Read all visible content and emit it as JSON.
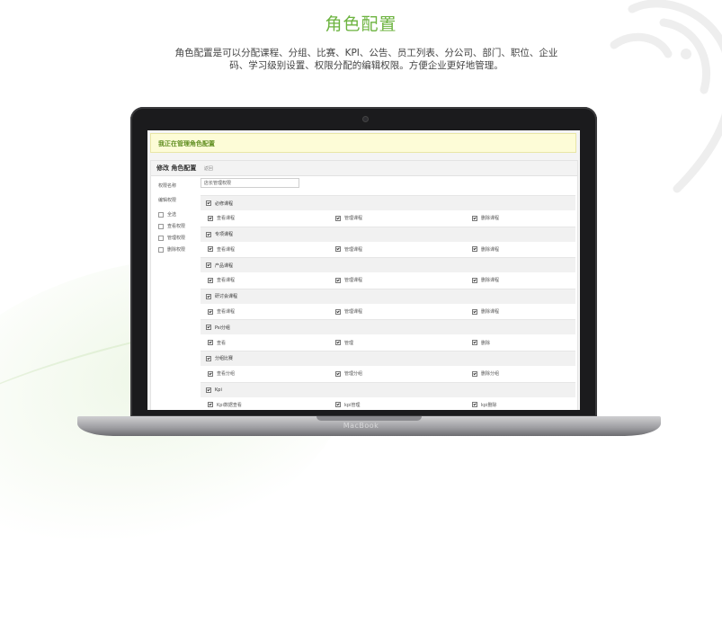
{
  "page": {
    "title": "角色配置",
    "description": "角色配置是可以分配课程、分组、比赛、KPI、公告、员工列表、分公司、部门、职位、企业码、学习级别设置、权限分配的编辑权限。方便企业更好地管理。"
  },
  "laptop": {
    "brand": "MacBook"
  },
  "app": {
    "notice": "我正在管理角色配置",
    "panel_title": "修改 角色配置",
    "panel_sub": "返回",
    "name_label": "权限名称",
    "name_value": "店长管理权限",
    "permissions_label": "编辑权限",
    "quick_options": [
      "全选",
      "查看权限",
      "管理权限",
      "删除权限"
    ],
    "groups": [
      {
        "name": "必修课程",
        "items": [
          "查看课程",
          "管理课程",
          "删除课程"
        ]
      },
      {
        "name": "专项课程",
        "items": [
          "查看课程",
          "管理课程",
          "删除课程"
        ]
      },
      {
        "name": "产品课程",
        "items": [
          "查看课程",
          "管理课程",
          "删除课程"
        ]
      },
      {
        "name": "研讨会课程",
        "items": [
          "查看课程",
          "管理课程",
          "删除课程"
        ]
      },
      {
        "name": "Psi分组",
        "items": [
          "查看",
          "管理",
          "删除"
        ]
      },
      {
        "name": "分组比赛",
        "items": [
          "查看分组",
          "管理分组",
          "删除分组"
        ]
      },
      {
        "name": "Kpi",
        "items": [
          "Kpi数据查看",
          "kpi管理",
          "kpi删除"
        ]
      }
    ]
  },
  "colors": {
    "accent": "#6cb33f",
    "notice_bg": "#fdfcd7",
    "notice_text": "#5f8d1f"
  }
}
